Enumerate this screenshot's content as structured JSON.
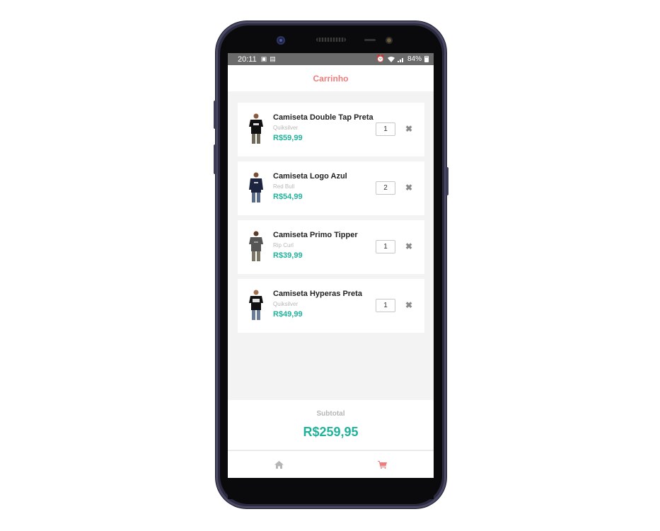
{
  "status_bar": {
    "time": "20:11",
    "battery": "84%"
  },
  "header": {
    "title": "Carrinho"
  },
  "cart": {
    "items": [
      {
        "name": "Camiseta Double Tap Preta",
        "brand": "Quiksilver",
        "price": "R$59,99",
        "quantity": "1"
      },
      {
        "name": "Camiseta Logo Azul",
        "brand": "Red Bull",
        "price": "R$54,99",
        "quantity": "2"
      },
      {
        "name": "Camiseta Primo Tipper",
        "brand": "Rip Curl",
        "price": "R$39,99",
        "quantity": "1"
      },
      {
        "name": "Camiseta Hyperas Preta",
        "brand": "Quiksilver",
        "price": "R$49,99",
        "quantity": "1"
      }
    ],
    "remove_icon": "✖"
  },
  "footer": {
    "subtotal_label": "Subtotal",
    "subtotal_value": "R$259,95"
  },
  "tabbar": {
    "home": {
      "icon": "home-icon",
      "active": false
    },
    "cart": {
      "icon": "cart-icon",
      "active": true
    }
  },
  "colors": {
    "accent": "#f07c7c",
    "price": "#1fb39b",
    "status_bar": "#6b6b6b"
  }
}
